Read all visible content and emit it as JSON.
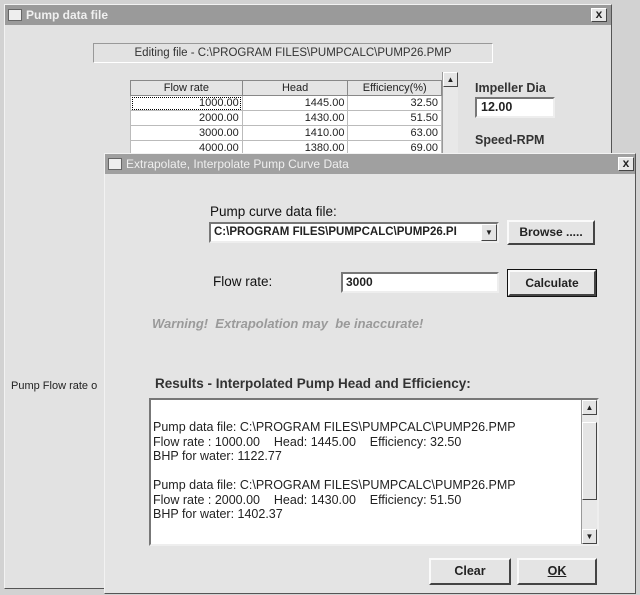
{
  "back_window": {
    "title": "Pump data file",
    "close_label": "x",
    "editing_label": "Editing file - C:\\PROGRAM FILES\\PUMPCALC\\PUMP26.PMP",
    "table": {
      "headers": [
        "Flow rate",
        "Head",
        "Efficiency(%)"
      ],
      "rows": [
        [
          "1000.00",
          "1445.00",
          "32.50"
        ],
        [
          "2000.00",
          "1430.00",
          "51.50"
        ],
        [
          "3000.00",
          "1410.00",
          "63.00"
        ],
        [
          "4000.00",
          "1380.00",
          "69.00"
        ]
      ]
    },
    "impeller_label": "Impeller Dia",
    "impeller_value": "12.00",
    "speed_label": "Speed-RPM",
    "status_text": "Pump Flow rate o"
  },
  "front_window": {
    "title": "Extrapolate, Interpolate Pump Curve Data",
    "close_label": "x",
    "pump_curve_label": "Pump curve data file:",
    "pump_curve_value": "C:\\PROGRAM FILES\\PUMPCALC\\PUMP26.PI",
    "browse_label": "Browse .....",
    "flow_rate_label": "Flow rate:",
    "flow_rate_value": "3000",
    "calculate_label": "Calculate",
    "warning_text": "Warning!  Extrapolation may  be inaccurate!",
    "results_label": "Results - Interpolated Pump Head and Efficiency:",
    "results_lines": [
      "Pump data file: C:\\PROGRAM FILES\\PUMPCALC\\PUMP26.PMP",
      "Flow rate : 1000.00    Head: 1445.00    Efficiency: 32.50",
      "BHP for water: 1122.77",
      "",
      "Pump data file: C:\\PROGRAM FILES\\PUMPCALC\\PUMP26.PMP",
      "Flow rate : 2000.00    Head: 1430.00    Efficiency: 51.50",
      "BHP for water: 1402.37"
    ],
    "clear_label": "Clear",
    "ok_label": "OK"
  }
}
